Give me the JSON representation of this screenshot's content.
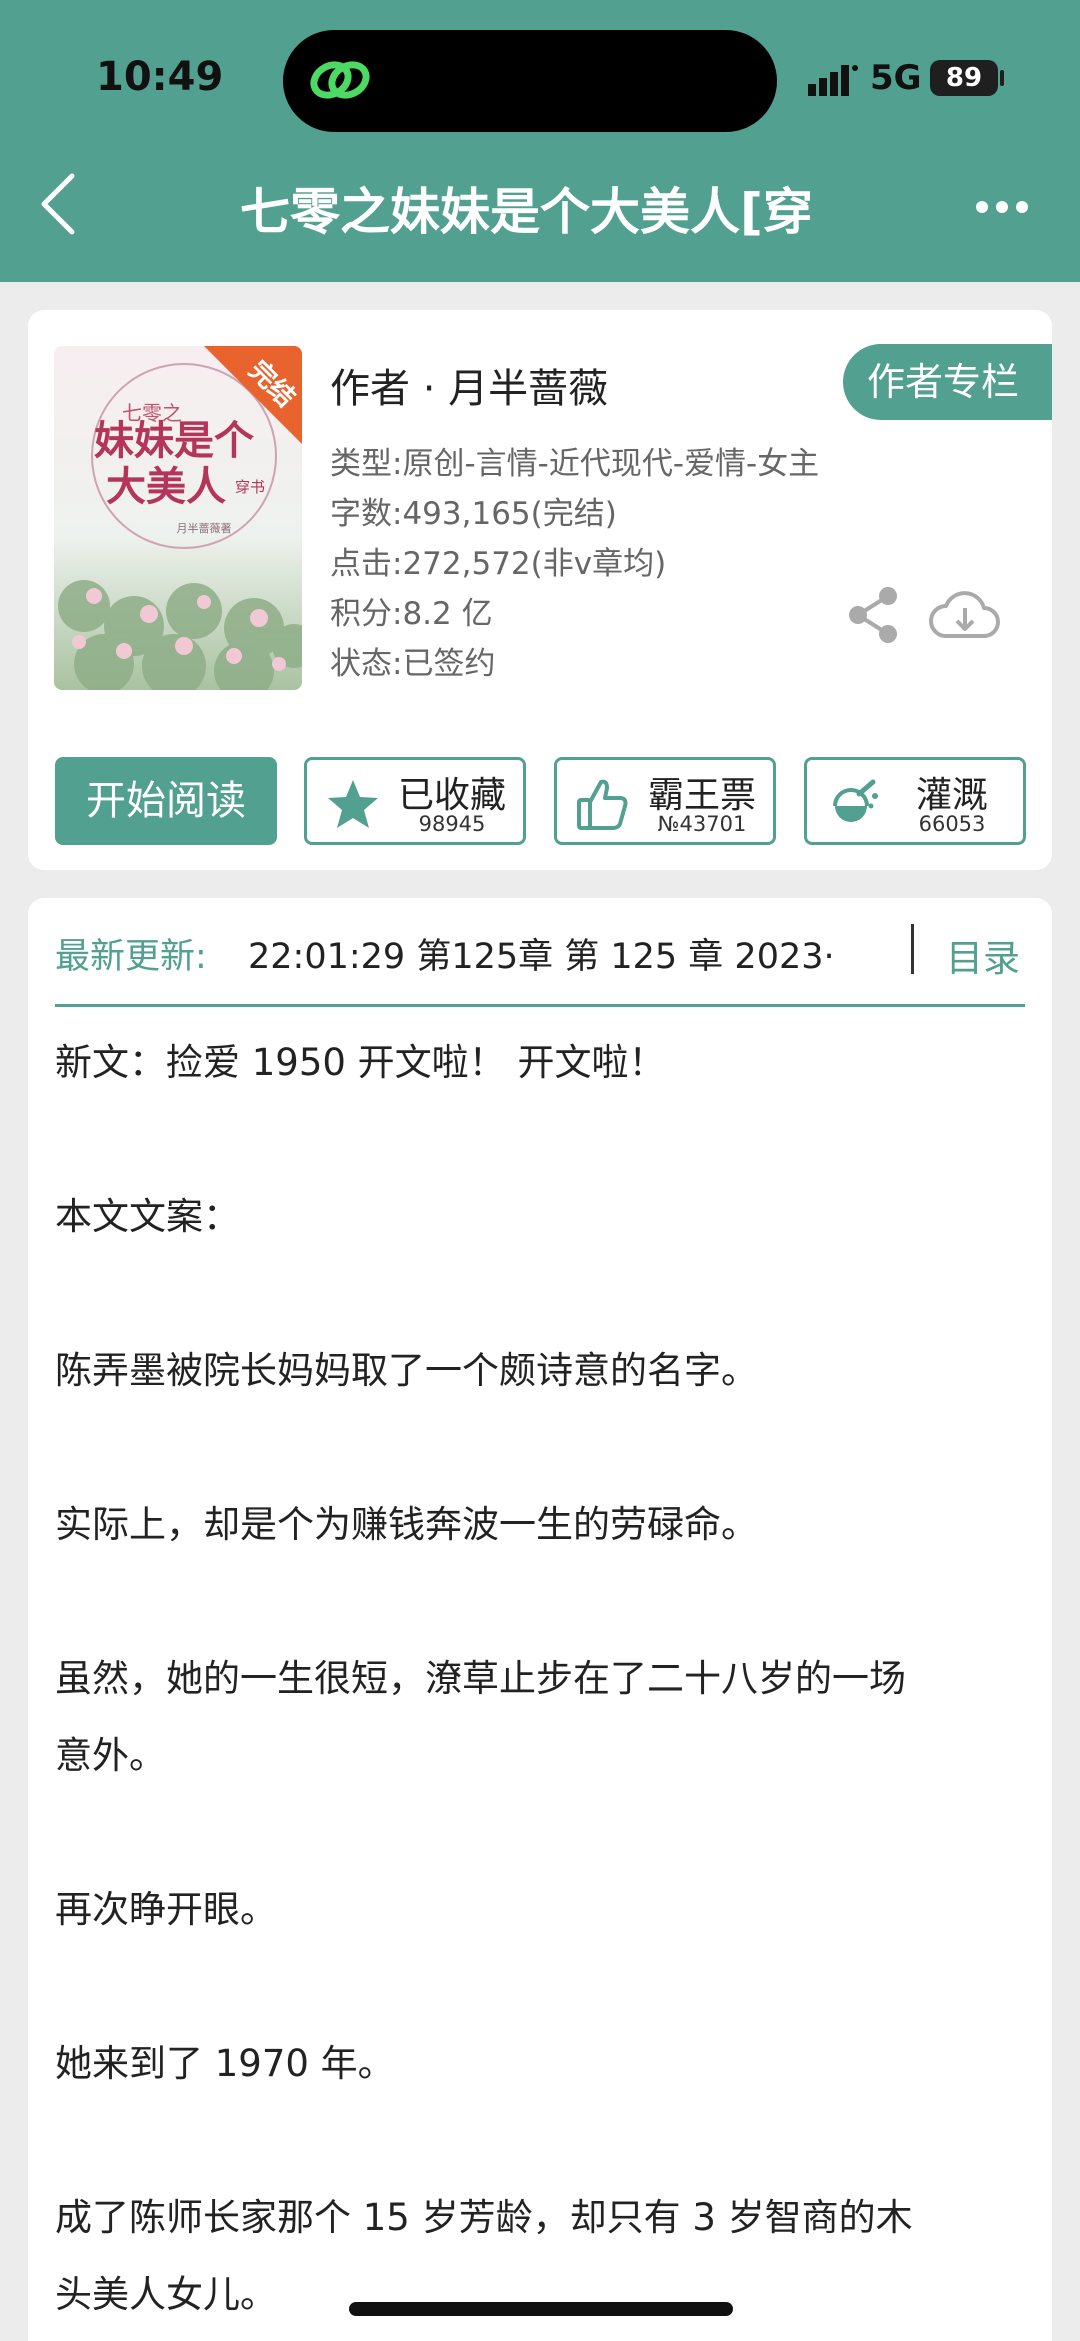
{
  "status_bar": {
    "time": "10:49",
    "network": "5G",
    "battery": "89"
  },
  "nav": {
    "title": "七零之妹妹是个大美人[穿"
  },
  "book": {
    "cover_badge": "完结",
    "cover_small_title": "七零之",
    "cover_title_line1": "妹妹是个",
    "cover_title_line2": "大美人",
    "cover_tag": "穿书",
    "cover_author": "月半蔷薇著",
    "author": "作者 · 月半蔷薇",
    "author_column": "作者专栏",
    "type": "类型:原创-言情-近代现代-爱情-女主",
    "words": "字数:493,165(完结)",
    "clicks": "点击:272,572(非v章均)",
    "score": "积分:8.2 亿",
    "state": "状态:已签约"
  },
  "actions": {
    "read": "开始阅读",
    "favorite": {
      "label": "已收藏",
      "count": "98945"
    },
    "vote": {
      "label": "霸王票",
      "count": "№43701"
    },
    "water": {
      "label": "灌溉",
      "count": "66053"
    }
  },
  "update": {
    "label": "最新更新:",
    "value": "22:01:29  第125章 第 125 章 2023·",
    "toc": "目录"
  },
  "content": {
    "p1": "新文：捡爱 1950  开文啦！  开文啦！",
    "p2": "本文文案：",
    "p3": "陈弄墨被院长妈妈取了一个颇诗意的名字。",
    "p4": "实际上，却是个为赚钱奔波一生的劳碌命。",
    "p5_l1": "虽然，她的一生很短，潦草止步在了二十八岁的一场",
    "p5_l2": "意外。",
    "p6": "再次睁开眼。",
    "p7": "她来到了 1970 年。",
    "p8_l1": "成了陈师长家那个 15 岁芳龄，却只有 3 岁智商的木",
    "p8_l2": "头美人女儿。"
  },
  "colors": {
    "accent": "#52a08f",
    "badge": "#e8632e"
  }
}
